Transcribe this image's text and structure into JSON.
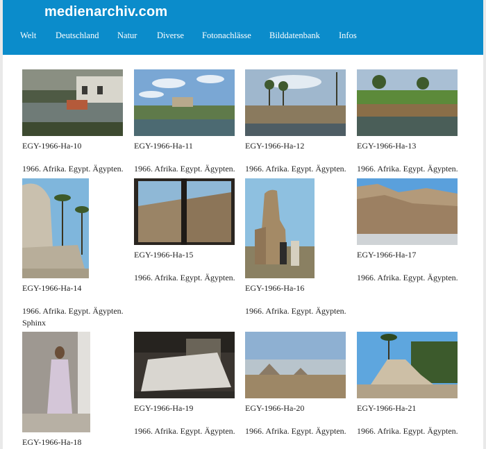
{
  "site": {
    "title": "medienarchiv.com"
  },
  "nav": {
    "items": [
      "Welt",
      "Deutschland",
      "Natur",
      "Diverse",
      "Fotonachlässe",
      "Bilddatenbank",
      "Infos"
    ]
  },
  "gallery": {
    "items": [
      {
        "id": "EGY-1966-Ha-10",
        "desc": "1966. Afrika. Egypt. Ägypten."
      },
      {
        "id": "EGY-1966-Ha-11",
        "desc": "1966. Afrika. Egypt. Ägypten."
      },
      {
        "id": "EGY-1966-Ha-12",
        "desc": "1966. Afrika. Egypt. Ägypten."
      },
      {
        "id": "EGY-1966-Ha-13",
        "desc": "1966. Afrika. Egypt. Ägypten."
      },
      {
        "id": "EGY-1966-Ha-14",
        "desc": "1966. Afrika. Egypt. Ägypten.",
        "desc2": "Sphinx"
      },
      {
        "id": "EGY-1966-Ha-15",
        "desc": "1966. Afrika. Egypt. Ägypten."
      },
      {
        "id": "EGY-1966-Ha-16",
        "desc": "1966. Afrika. Egypt. Ägypten."
      },
      {
        "id": "EGY-1966-Ha-17",
        "desc": "1966. Afrika. Egypt. Ägypten."
      },
      {
        "id": "EGY-1966-Ha-18",
        "desc": ""
      },
      {
        "id": "EGY-1966-Ha-19",
        "desc": "1966. Afrika. Egypt. Ägypten."
      },
      {
        "id": "EGY-1966-Ha-20",
        "desc": "1966. Afrika. Egypt. Ägypten."
      },
      {
        "id": "EGY-1966-Ha-21",
        "desc": "1966. Afrika. Egypt. Ägypten."
      }
    ]
  },
  "colors": {
    "header": "#0b8ccb",
    "background": "#e9e9e9",
    "text": "#222222"
  }
}
